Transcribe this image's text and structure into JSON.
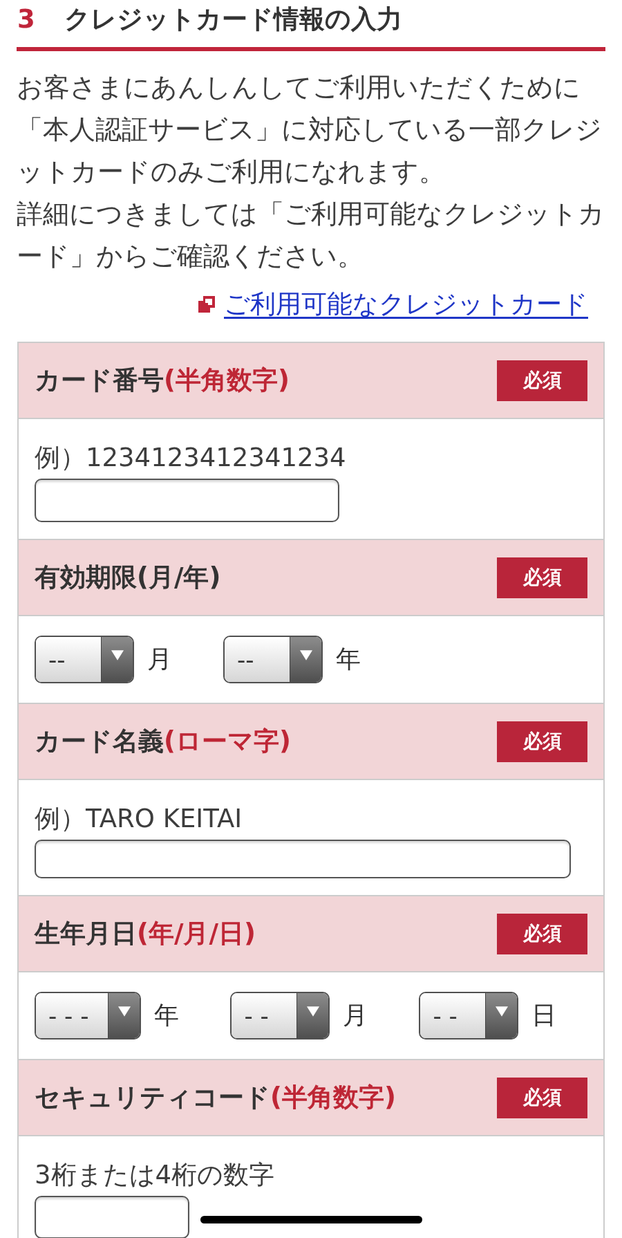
{
  "section": {
    "number": "3",
    "title": "クレジットカード情報の入力"
  },
  "intro": [
    "お客さまにあんしんしてご利用いただくために「本人認証サービス」に対応している一部クレジットカードのみご利用になれます。",
    "詳細につきましては「ご利用可能なクレジットカード」からご確認ください。"
  ],
  "link": {
    "text": "ご利用可能なクレジットカード"
  },
  "fields": [
    {
      "label": "カード番号",
      "note": "(半角数字)",
      "badge": "必須",
      "kind": "number",
      "caption": "例）1234123412341234"
    },
    {
      "label": "有効期限(月/年)",
      "badge": "必須",
      "kind": "date",
      "selects": [
        {
          "value": "--",
          "unit": "月"
        },
        {
          "value": "--",
          "unit": "年"
        }
      ]
    },
    {
      "label": "カード名義",
      "note": "(ローマ字)",
      "badge": "必須",
      "kind": "name",
      "caption": "例）TARO KEITAI"
    },
    {
      "label": "生年月日",
      "note": "(年/月/日)",
      "badge": "必須",
      "kind": "date",
      "selects": [
        {
          "value": "- - -",
          "unit": "年"
        },
        {
          "value": "- -",
          "unit": "月"
        },
        {
          "value": "- -",
          "unit": "日"
        }
      ]
    },
    {
      "label": "セキュリティコード",
      "note": "(半角数字)",
      "badge": "必須",
      "kind": "code",
      "caption": "3桁または4桁の数字"
    }
  ]
}
